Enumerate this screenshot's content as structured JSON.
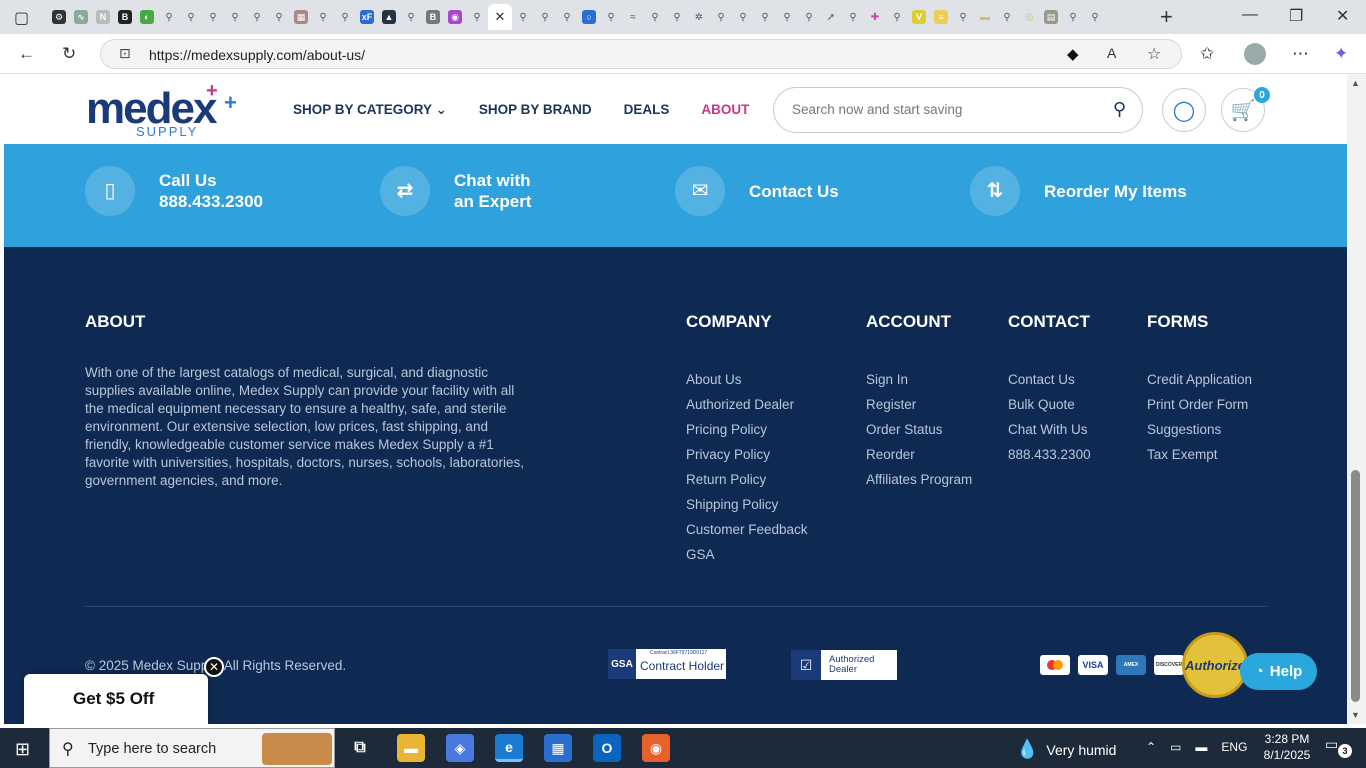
{
  "browser": {
    "url": "https://medexsupply.com/about-us/",
    "active_tab_close": "✕",
    "new_tab": "+",
    "window_controls": [
      "—",
      "❐",
      "✕"
    ]
  },
  "header": {
    "logo_main": "medex",
    "logo_sub": "SUPPLY",
    "nav": {
      "shop_by_category": "SHOP BY CATEGORY",
      "shop_by_brand": "SHOP BY BRAND",
      "deals": "DEALS",
      "about": "ABOUT"
    },
    "search_placeholder": "Search now and start saving",
    "cart_count": "0"
  },
  "contact_bar": {
    "call": {
      "line1": "Call Us",
      "line2": "888.433.2300"
    },
    "chat": {
      "line1": "Chat with",
      "line2": "an Expert"
    },
    "contact": "Contact Us",
    "reorder": "Reorder My Items"
  },
  "footer": {
    "about": {
      "heading": "ABOUT",
      "text": "With one of the largest catalogs of medical, surgical, and diagnostic supplies available online, Medex Supply can provide your facility with all the medical equipment necessary to ensure a healthy, safe, and sterile environment. Our extensive selection, low prices, fast shipping, and friendly, knowledgeable customer service makes Medex Supply a #1 favorite with universities, hospitals, doctors, nurses, schools, laboratories, government agencies, and more."
    },
    "company": {
      "heading": "COMPANY",
      "links": [
        "About Us",
        "Authorized Dealer",
        "Pricing Policy",
        "Privacy Policy",
        "Return Policy",
        "Shipping Policy",
        "Customer Feedback",
        "GSA"
      ]
    },
    "account": {
      "heading": "ACCOUNT",
      "links": [
        "Sign In",
        "Register",
        "Order Status",
        "Reorder",
        "Affiliates Program"
      ]
    },
    "contact": {
      "heading": "CONTACT",
      "links": [
        "Contact Us",
        "Bulk Quote",
        "Chat With Us",
        "888.433.2300"
      ]
    },
    "forms": {
      "heading": "FORMS",
      "links": [
        "Credit Application",
        "Print Order Form",
        "Suggestions",
        "Tax Exempt"
      ]
    },
    "copyright": "© 2025 Medex Supply. All Rights Reserved.",
    "gsa_badge": {
      "logo": "GSA",
      "contract_no": "Contract 36F79719D0117",
      "label": "Contract Holder"
    },
    "authorized_dealer": {
      "line1": "Authorized",
      "line2": "Dealer"
    },
    "cards": [
      "mastercard",
      "VISA",
      "AMERICAN EXPRESS",
      "DISCOVER"
    ],
    "authorize_seal": "Authorize.Net"
  },
  "widgets": {
    "help": "Help",
    "promo": "Get $5 Off"
  },
  "taskbar": {
    "search": "Type here to search",
    "weather": "Very humid",
    "lang": "ENG",
    "time": "3:28 PM",
    "date": "8/1/2025",
    "notifications": "3"
  },
  "colors": {
    "accent_blue": "#2fa1dc",
    "footer_navy": "#0f2a52",
    "brand_pink": "#c23a8a"
  }
}
